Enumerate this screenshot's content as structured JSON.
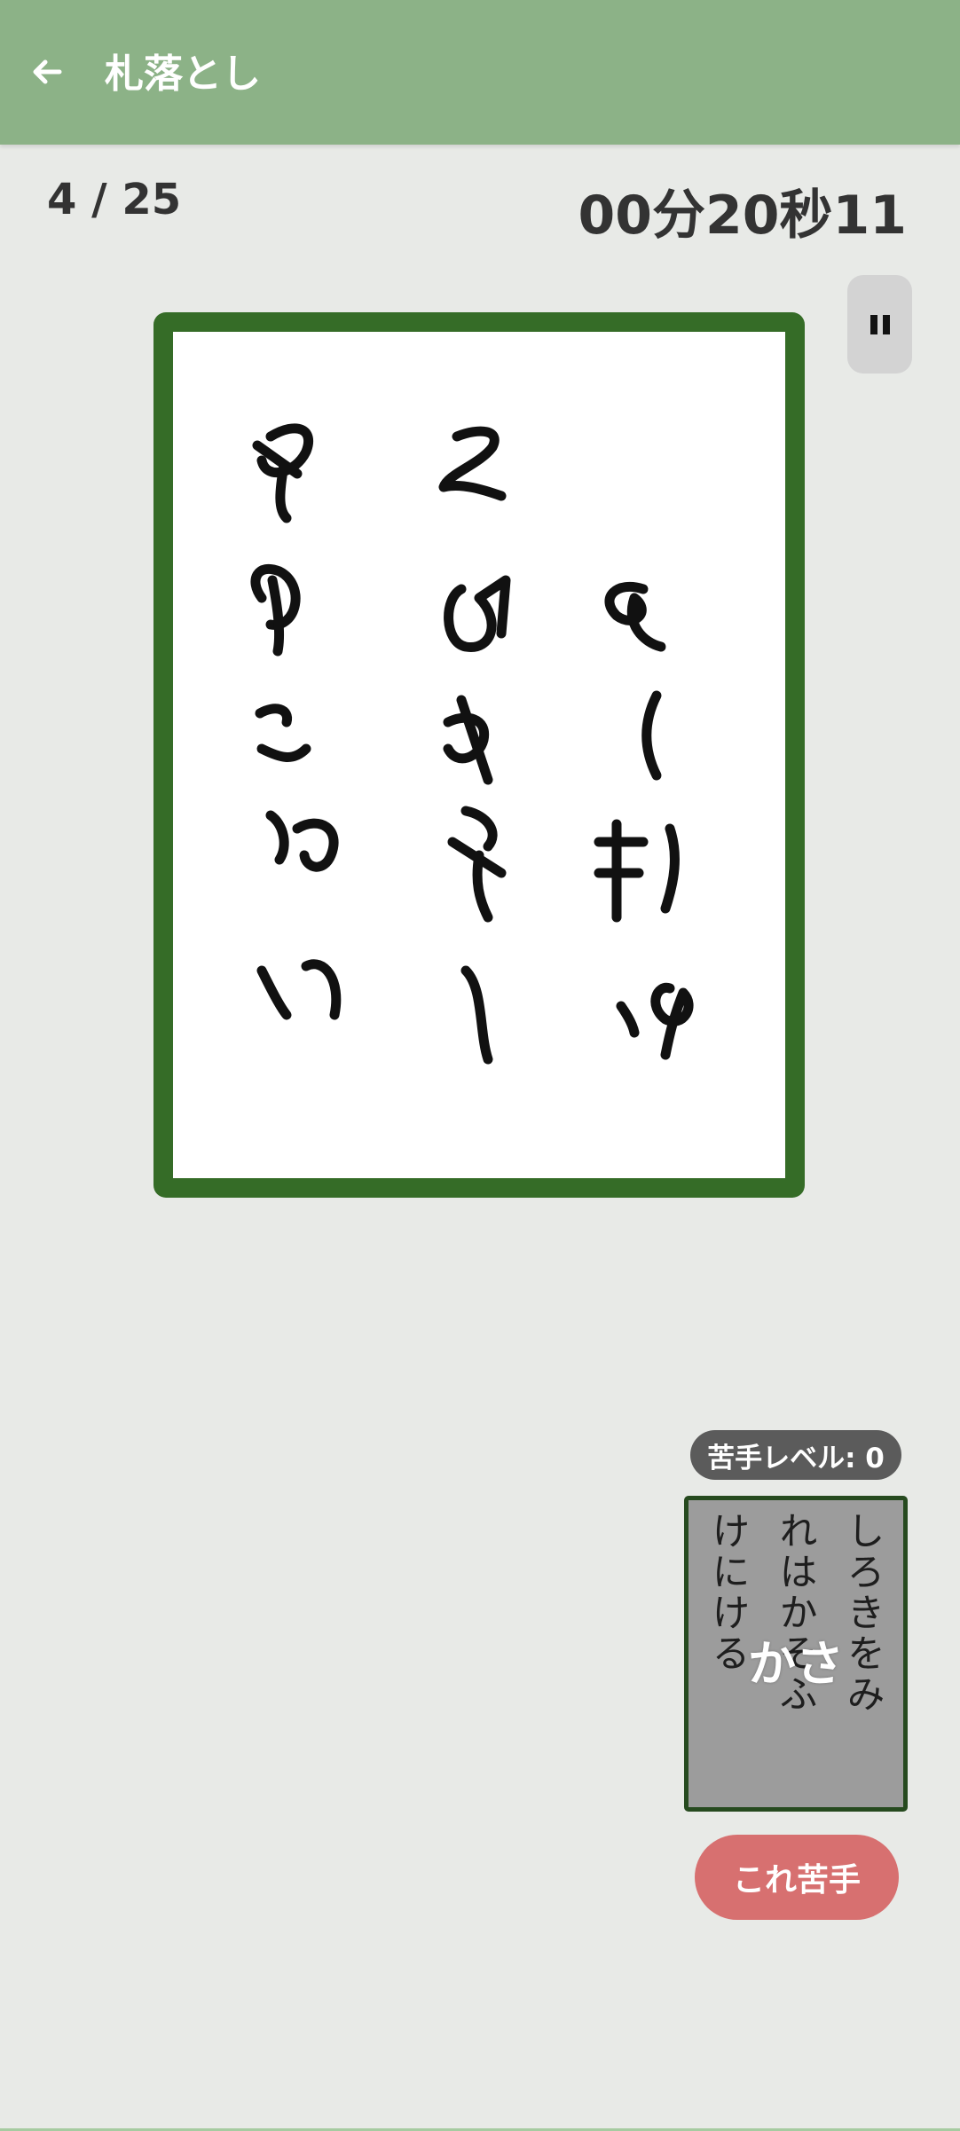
{
  "appbar": {
    "title": "札落とし",
    "back_icon": "arrow-left-icon"
  },
  "status": {
    "progress": "4 / 25",
    "timer": "00分20秒11"
  },
  "pause": {
    "icon": "pause-icon"
  },
  "card": {
    "description_icon": "mirrored-handwritten-kana-card",
    "columns": [
      [
        "か",
        "に",
        "く",
        "み",
        "ら"
      ],
      [
        "ゆ",
        "え",
        "み",
        "か",
        "く"
      ],
      [
        "へ",
        "け",
        "し",
        "ね",
        "し"
      ]
    ]
  },
  "weak_card": {
    "level_label": "苦手レベル: 0",
    "verses": [
      "しろきをみ",
      "れはかそふ",
      "けにける"
    ],
    "label": "かさ"
  },
  "actions": {
    "mark_hard_label": "これ苦手"
  },
  "colors": {
    "appbar": "#8cb287",
    "background": "#e8eae7",
    "card_border": "#356c27",
    "mini_card_border": "#264a1f",
    "hard_button": "#d77070",
    "badge": "#5b5b5b"
  }
}
